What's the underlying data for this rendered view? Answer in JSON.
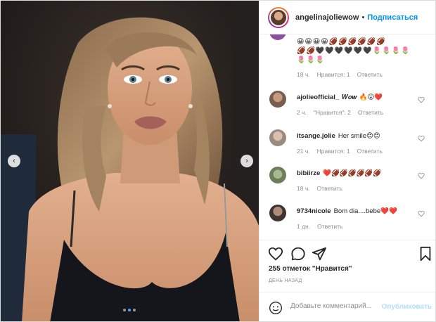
{
  "header": {
    "username": "angelinajoliewow",
    "separator": "•",
    "follow_label": "Подписаться"
  },
  "top_comment": {
    "emojis_line1": "😀😀😀😀🏈🏈🏈🏈🏈🏈",
    "emojis_line2": "🏈🏈🖤🖤🖤🖤🖤🖤🌷🌷🌷🌷",
    "emojis_line3": "🌷🌷🌷",
    "time": "18 ч.",
    "likes": "Нравится: 1",
    "reply": "Ответить"
  },
  "comments": [
    {
      "user": "ajolieofficial_",
      "text": "𝑾𝒐𝒘 🔥😮❤️",
      "time": "2 ч.",
      "likes": "\"Нравится\": 2",
      "reply": "Ответить",
      "avatar_color": "#7a5c4e"
    },
    {
      "user": "itsange.jolie",
      "text": "Her smile😍😍",
      "time": "21 ч.",
      "likes": "Нравится: 1",
      "reply": "Ответить",
      "avatar_color": "#9a8a80"
    },
    {
      "user": "bibiirze",
      "text": "❤️🏈🏈🏈🏈🏈🏈",
      "time": "18 ч.",
      "likes": "",
      "reply": "Ответить",
      "avatar_color": "#6d7f5a"
    },
    {
      "user": "9734nicole",
      "text": "Bom dia....bebe❤️❤️",
      "time": "1 дн.",
      "likes": "",
      "reply": "Ответить",
      "avatar_color": "#3e3532"
    }
  ],
  "actions": {
    "like_icon": "heart-outline-icon",
    "comment_icon": "speech-bubble-icon",
    "share_icon": "paper-plane-icon",
    "save_icon": "bookmark-icon"
  },
  "likes_count": "255 отметок \"Нравится\"",
  "posted": "ДЕНЬ НАЗАД",
  "add_comment": {
    "placeholder": "Добавьте комментарий...",
    "post_label": "Опубликовать"
  },
  "carousel": {
    "prev": "‹",
    "next": "›",
    "total_slides": 3,
    "active_slide": 2
  },
  "colors": {
    "accent": "#0095f6",
    "post_disabled": "#b2dffc",
    "muted": "#8e8e8e",
    "heart_red": "#ed4956"
  }
}
